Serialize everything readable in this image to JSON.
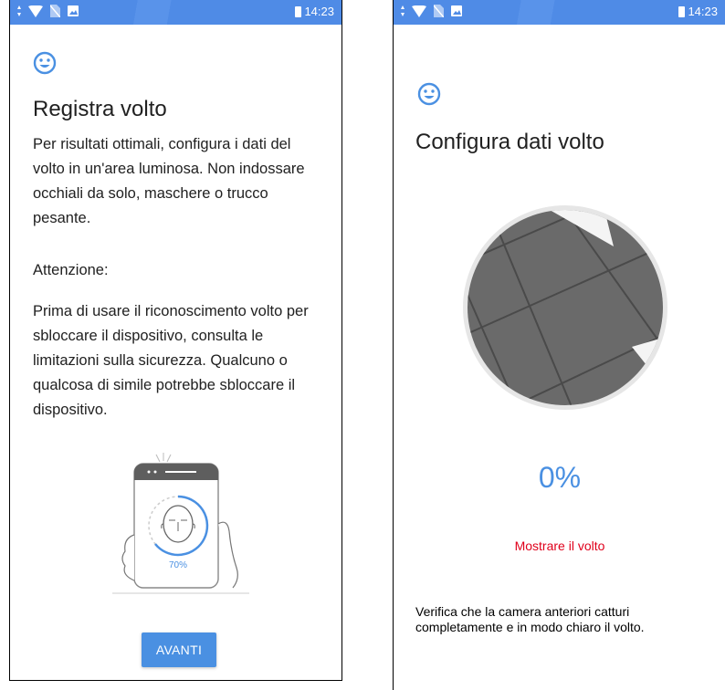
{
  "status_bar": {
    "time": "14:23"
  },
  "left_screen": {
    "title": "Registra volto",
    "description": "Per risultati ottimali, configura i dati del volto in un'area luminosa. Non indossare occhiali da solo, maschere o trucco pesante.",
    "attention_label": "Attenzione:",
    "warning_text": "Prima di usare il riconoscimento volto per sbloccare il dispositivo, consulta le limitazioni sulla sicurezza. Qualcuno o qualcosa di simile potrebbe sbloccare il dispositivo.",
    "illustration_percent": "70%",
    "next_button": "AVANTI"
  },
  "right_screen": {
    "title": "Configura dati volto",
    "progress": "0%",
    "error_text": "Mostrare il volto",
    "hint_text": "Verifica che la camera anteriori catturi completamente e in modo chiaro il volto."
  },
  "colors": {
    "accent": "#4a90e2",
    "status_bar": "#4f8be6",
    "error": "#e0001b"
  },
  "icons": [
    "wifi-icon",
    "no-sim-icon",
    "image-icon",
    "battery-icon",
    "face-icon"
  ]
}
